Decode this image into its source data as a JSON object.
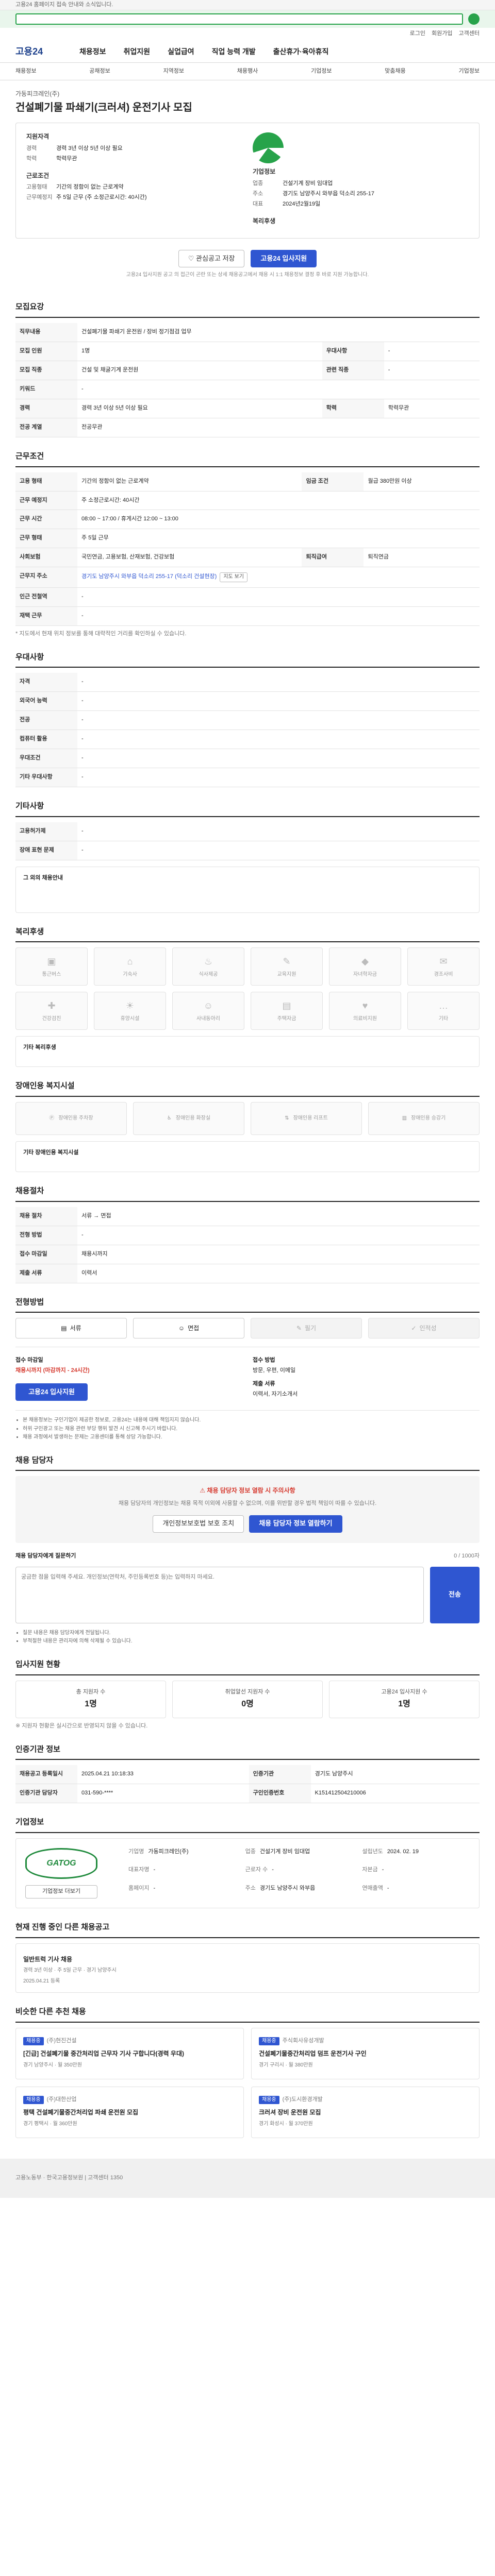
{
  "topbar": {
    "notice": "고용24 홈페이지 접속 안내와 소식입니다."
  },
  "util": {
    "links": [
      "로그인",
      "회원가입",
      "고객센터"
    ]
  },
  "gnb": {
    "logo": "고용24",
    "menus": [
      "채용정보",
      "취업지원",
      "실업급여",
      "직업 능력 개발",
      "출산휴가·육아휴직"
    ]
  },
  "subnav": {
    "items": [
      "채용정보",
      "공채정보",
      "지역정보",
      "채용행사",
      "기업정보",
      "맞춤채용",
      "기업정보"
    ]
  },
  "job": {
    "company": "가동피크레인(주)",
    "title": "건설폐기물 파쇄기(크러셔) 운전기사 모집",
    "summary": {
      "qualification_title": "지원자격",
      "qualification": [
        [
          "경력",
          "경력 3년 이상 5년 이상 필요"
        ],
        [
          "학력",
          "학력무관"
        ]
      ],
      "terms_title": "근로조건",
      "terms": [
        [
          "고용형태",
          "기간의 정함이 없는 근로계약"
        ],
        [
          "근무예정지",
          "주 5일 근무 (주 소정근로시간: 40시간)"
        ]
      ],
      "corp_title": "기업정보",
      "corp": [
        [
          "업종",
          "건설기계 장비 임대업"
        ],
        [
          "주소",
          "경기도 남양주시 와부읍 덕소리 255-17"
        ],
        [
          "대표",
          "2024년2월19일"
        ]
      ],
      "welfare_title": "복리후생"
    },
    "buttons": {
      "scrap": "관심공고 저장",
      "apply": "고용24 입사지원"
    },
    "note": "고용24 입사지원 공고 의 접근이 곤란 또는 상세 채용공고에서 채용 시 1:1 채용정보 결정 후 바로 지원 가능합니다."
  },
  "s1": {
    "title": "모집요강",
    "rows": [
      {
        "k": "직무내용",
        "v": "건설폐기물 파쇄기 운전원 / 장비 정기점검 업무"
      },
      {
        "k": "모집 인원",
        "v": "1명"
      },
      {
        "k": "우대사항",
        "v": "-"
      },
      {
        "k": "모집 직종",
        "v": "건설 및 채굴기계 운전원"
      },
      {
        "k": "관련 직종",
        "v": "-"
      },
      {
        "k": "키워드",
        "v": "-"
      },
      {
        "k": "경력",
        "v": "경력 3년 이상 5년 이상 필요"
      },
      {
        "k": "학력",
        "v": "학력무관"
      },
      {
        "k": "전공 계열",
        "v": "전공무관"
      }
    ]
  },
  "s2": {
    "title": "근무조건",
    "rows": [
      {
        "k": "고용 형태",
        "v": "기간의 정함이 없는 근로계약"
      },
      {
        "k": "임금 조건",
        "v": "월급 380만원 이상"
      },
      {
        "k": "근무 예정지",
        "v": "주 소정근로시간: 40시간"
      },
      {
        "k": "근무 시간",
        "v": "08:00 ~ 17:00 / 휴게시간 12:00 ~ 13:00"
      },
      {
        "k": "근무 형태",
        "v": "주 5일 근무"
      },
      {
        "k": "사회보험",
        "v": "국민연금, 고용보험, 산재보험, 건강보험"
      },
      {
        "k": "퇴직급여",
        "v": "퇴직연금"
      },
      {
        "k": "근무지 주소",
        "v": "경기도 남양주시 와부읍 덕소리 255-17 (덕소리 건설현장)"
      },
      {
        "k": "인근 전철역",
        "v": "-"
      },
      {
        "k": "재택 근무",
        "v": "-"
      }
    ],
    "map_btn": "지도 보기",
    "footnote": "* 지도에서 현재 위치 정보를 통해 대략적인 거리를 확인하실 수 있습니다."
  },
  "s3": {
    "title": "우대사항",
    "rows": [
      {
        "k": "자격",
        "v": "-"
      },
      {
        "k": "외국어 능력",
        "v": "-"
      },
      {
        "k": "전공",
        "v": "-"
      },
      {
        "k": "컴퓨터 활용",
        "v": "-"
      },
      {
        "k": "우대조건",
        "v": "-"
      },
      {
        "k": "기타 우대사항",
        "v": "-"
      }
    ]
  },
  "s4": {
    "title": "기타사항",
    "rows": [
      {
        "k": "고용허가제",
        "v": "-"
      },
      {
        "k": "장애 표현 문제",
        "v": "-"
      }
    ],
    "note_title": "그 외의 채용안내"
  },
  "s5": {
    "title": "복리후생",
    "items": [
      "통근버스",
      "기숙사",
      "식사제공",
      "교육지원",
      "자녀학자금",
      "경조사비",
      "건강검진",
      "휴양시설",
      "사내동아리",
      "주택자금",
      "의료비지원",
      "기타"
    ],
    "other_label": "기타 복리후생"
  },
  "s6": {
    "title": "장애인용 복지시설",
    "items": [
      "장애인용 주차장",
      "장애인용 화장실",
      "장애인용 리프트",
      "장애인용 승강기"
    ],
    "other_label": "기타 장애인용 복지시설"
  },
  "s7": {
    "title": "채용절차",
    "rows": [
      {
        "k": "채용 절차",
        "v": "서류 → 면접"
      },
      {
        "k": "전형 방법",
        "v": "-"
      },
      {
        "k": "접수 마감일",
        "v": "채용시까지"
      },
      {
        "k": "제출 서류",
        "v": "이력서"
      }
    ]
  },
  "s8": {
    "title": "전형방법",
    "methods": [
      "서류",
      "면접",
      "필기",
      "인적성"
    ],
    "deadline_label": "접수 마감일",
    "deadline": "채용시까지 (마감까지 - 24시간)",
    "method_label": "접수 방법",
    "method": "방문, 우편, 이메일",
    "docs_label": "제출 서류",
    "docs": "이력서, 자기소개서",
    "apply_btn": "고용24 입사지원",
    "notices": [
      "본 채용정보는 구인기업이 제공한 정보로, 고용24는 내용에 대해 책임지지 않습니다.",
      "허위 구인광고 또는 채용 관련 부당 행위 발견 시 신고해 주시기 바랍니다.",
      "채용 과정에서 발생하는 문제는 고용센터를 통해 상담 가능합니다."
    ]
  },
  "s9": {
    "title": "채용 담당자",
    "alert": "채용 담당자 정보 열람 시 주의사항",
    "desc": "채용 담당자의 개인정보는 채용 목적 이외에 사용할 수 없으며, 이를 위반할 경우 법적 책임이 따를 수 있습니다.",
    "btn_outline": "개인정보보호법 보호 조치",
    "btn_primary": "채용 담당자 정보 열람하기",
    "qa_label": "채용 담당자에게 질문하기",
    "qa_counter": "0 / 1000자",
    "qa_placeholder": "궁금한 점을 입력해 주세요. 개인정보(연락처, 주민등록번호 등)는 입력하지 마세요.",
    "qa_submit": "전송",
    "qa_notes": [
      "질문 내용은 채용 담당자에게 전달됩니다.",
      "부적절한 내용은 관리자에 의해 삭제될 수 있습니다."
    ]
  },
  "s10": {
    "title": "입사지원 현황",
    "stats": [
      {
        "t": "총 지원자 수",
        "n": "1명"
      },
      {
        "t": "취업알선 지원자 수",
        "n": "0명"
      },
      {
        "t": "고용24 입사지원 수",
        "n": "1명"
      }
    ],
    "note": "※ 지원자 현황은 실시간으로 반영되지 않을 수 있습니다."
  },
  "s11": {
    "title": "인증기관 정보",
    "rows": [
      {
        "k": "채용공고 등록일시",
        "v": "2025.04.21 10:18:33",
        "k2": "인증기관",
        "v2": "경기도 남양주시"
      },
      {
        "k": "인증기관 담당자",
        "v": "031-590-****",
        "k2": "구인인증번호",
        "v2": "K151412504210006"
      }
    ]
  },
  "s12": {
    "title": "기업정보",
    "logo_text": "GATOG",
    "more_btn": "기업정보 더보기",
    "fields": [
      [
        "기업명",
        "가동피크레인(주)"
      ],
      [
        "업종",
        "건설기계 장비 임대업"
      ],
      [
        "설립년도",
        "2024. 02. 19"
      ],
      [
        "대표자명",
        "-"
      ],
      [
        "근로자 수",
        "-"
      ],
      [
        "자본금",
        "-"
      ],
      [
        "홈페이지",
        "-"
      ],
      [
        "주소",
        "경기도 남양주시 와부읍"
      ],
      [
        "연매출액",
        "-"
      ]
    ]
  },
  "s13": {
    "title": "현재 진행 중인 다른 채용공고",
    "job_title": "일반트럭 기사 채용",
    "job_meta": "경력 3년 이상 · 주 5일 근무 · 경기 남양주시",
    "date": "2025.04.21 등록"
  },
  "s14": {
    "title": "비슷한 다른 추천 채용",
    "cards": [
      {
        "badge": "채용중",
        "company": "(주)현진건설",
        "title": "[긴급] 건설폐기물 중간처리업 근무자 기사 구합니다(경력 우대)",
        "meta": "경기 남양주시 · 월 350만원"
      },
      {
        "badge": "채용중",
        "company": "주식회사유성개발",
        "title": "건설폐기물중간처리업 덤프 운전기사 구인",
        "meta": "경기 구리시 · 월 380만원"
      },
      {
        "badge": "채용중",
        "company": "(주)대한산업",
        "title": "평택 건설폐기물중간처리업 파쇄 운전원 모집",
        "meta": "경기 평택시 · 월 360만원"
      },
      {
        "badge": "채용중",
        "company": "(주)도시환경개발",
        "title": "크러셔 장비 운전원 모집",
        "meta": "경기 화성시 · 월 370만원"
      }
    ]
  },
  "footer": {
    "text": "고용노동부 · 한국고용정보원 | 고객센터 1350"
  }
}
